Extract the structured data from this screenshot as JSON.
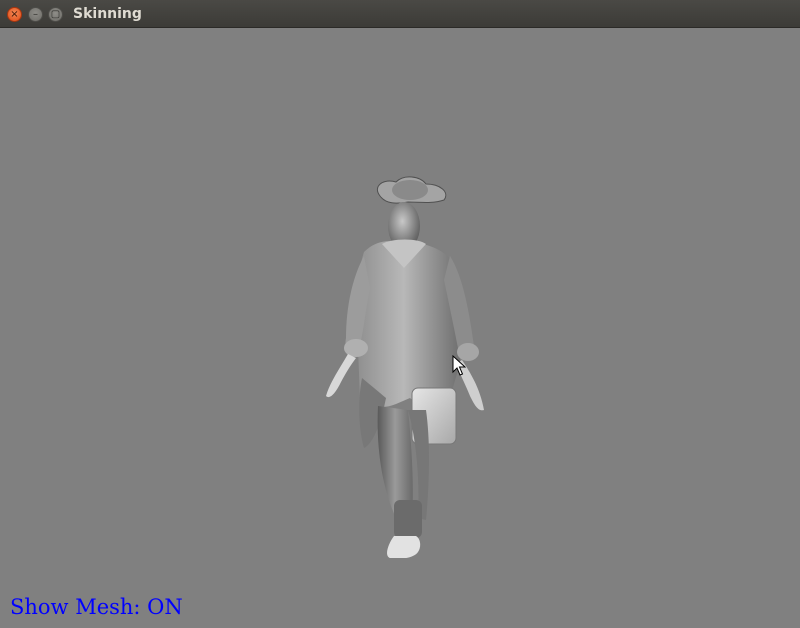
{
  "window": {
    "title": "Skinning",
    "close_glyph": "×",
    "minimize_glyph": "–",
    "maximize_glyph": "▢"
  },
  "viewport": {
    "background_color": "#808080",
    "model_description_icon": "skinned-character-model"
  },
  "overlay": {
    "status_text": "Show Mesh: ON",
    "status_color": "#0000ff"
  },
  "icons": {
    "cursor": "arrow-cursor-icon"
  }
}
